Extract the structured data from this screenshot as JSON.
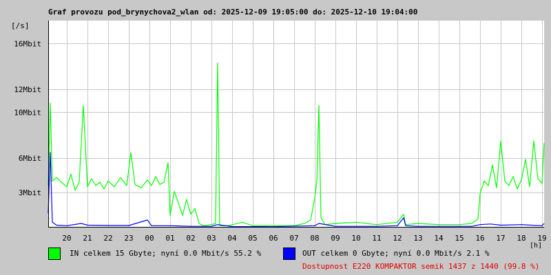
{
  "chart_data": {
    "type": "line",
    "title": "Graf provozu pod_brynychova2_wlan od: 2025-12-09 19:05:00 do: 2025-12-10 19:04:00",
    "ylabel": "[/s]",
    "xlabel": "[h]",
    "ylim": [
      0,
      18
    ],
    "xlim": [
      19.1,
      43.1
    ],
    "y_ticks": [
      {
        "value": 3,
        "label": "3Mbit"
      },
      {
        "value": 6,
        "label": "6Mbit"
      },
      {
        "value": 10,
        "label": "10Mbit"
      },
      {
        "value": 12,
        "label": "12Mbit"
      },
      {
        "value": 16,
        "label": "16Mbit"
      }
    ],
    "x_ticks": [
      {
        "value": 20,
        "label": "20"
      },
      {
        "value": 21,
        "label": "21"
      },
      {
        "value": 22,
        "label": "22"
      },
      {
        "value": 23,
        "label": "23"
      },
      {
        "value": 24,
        "label": "00"
      },
      {
        "value": 25,
        "label": "01"
      },
      {
        "value": 26,
        "label": "02"
      },
      {
        "value": 27,
        "label": "03"
      },
      {
        "value": 28,
        "label": "04"
      },
      {
        "value": 29,
        "label": "05"
      },
      {
        "value": 30,
        "label": "06"
      },
      {
        "value": 31,
        "label": "07"
      },
      {
        "value": 32,
        "label": "08"
      },
      {
        "value": 33,
        "label": "09"
      },
      {
        "value": 34,
        "label": "10"
      },
      {
        "value": 35,
        "label": "11"
      },
      {
        "value": 36,
        "label": "12"
      },
      {
        "value": 37,
        "label": "13"
      },
      {
        "value": 38,
        "label": "14"
      },
      {
        "value": 39,
        "label": "15"
      },
      {
        "value": 40,
        "label": "16"
      },
      {
        "value": 41,
        "label": "17"
      },
      {
        "value": 42,
        "label": "18"
      },
      {
        "value": 43,
        "label": "19"
      }
    ],
    "grid": true,
    "series": [
      {
        "name": "IN",
        "color": "#00ff00",
        "points": [
          [
            19.1,
            3.6
          ],
          [
            19.2,
            10.8
          ],
          [
            19.3,
            4.0
          ],
          [
            19.5,
            4.3
          ],
          [
            19.8,
            3.8
          ],
          [
            20.0,
            3.5
          ],
          [
            20.2,
            4.6
          ],
          [
            20.4,
            3.2
          ],
          [
            20.6,
            3.9
          ],
          [
            20.8,
            10.6
          ],
          [
            21.0,
            3.5
          ],
          [
            21.2,
            4.2
          ],
          [
            21.4,
            3.6
          ],
          [
            21.6,
            3.9
          ],
          [
            21.8,
            3.3
          ],
          [
            22.0,
            4.0
          ],
          [
            22.3,
            3.5
          ],
          [
            22.6,
            4.3
          ],
          [
            22.9,
            3.6
          ],
          [
            23.1,
            6.5
          ],
          [
            23.3,
            3.7
          ],
          [
            23.6,
            3.4
          ],
          [
            23.9,
            4.1
          ],
          [
            24.1,
            3.6
          ],
          [
            24.3,
            4.4
          ],
          [
            24.5,
            3.7
          ],
          [
            24.7,
            3.9
          ],
          [
            24.9,
            5.6
          ],
          [
            25.0,
            1.0
          ],
          [
            25.2,
            3.1
          ],
          [
            25.4,
            2.1
          ],
          [
            25.6,
            1.0
          ],
          [
            25.8,
            2.4
          ],
          [
            26.0,
            1.1
          ],
          [
            26.2,
            1.6
          ],
          [
            26.4,
            0.3
          ],
          [
            26.6,
            0.1
          ],
          [
            27.0,
            0.2
          ],
          [
            27.2,
            0.3
          ],
          [
            27.3,
            14.3
          ],
          [
            27.4,
            0.1
          ],
          [
            27.8,
            0.1
          ],
          [
            28.5,
            0.4
          ],
          [
            29.0,
            0.1
          ],
          [
            31.0,
            0.1
          ],
          [
            31.5,
            0.3
          ],
          [
            31.8,
            0.6
          ],
          [
            32.0,
            2.5
          ],
          [
            32.1,
            4.0
          ],
          [
            32.2,
            10.6
          ],
          [
            32.3,
            0.8
          ],
          [
            32.5,
            0.2
          ],
          [
            33.0,
            0.3
          ],
          [
            34.0,
            0.4
          ],
          [
            35.0,
            0.2
          ],
          [
            36.0,
            0.4
          ],
          [
            36.3,
            1.1
          ],
          [
            36.4,
            0.2
          ],
          [
            37.0,
            0.3
          ],
          [
            38.0,
            0.2
          ],
          [
            39.0,
            0.2
          ],
          [
            39.6,
            0.3
          ],
          [
            39.9,
            0.7
          ],
          [
            40.0,
            2.9
          ],
          [
            40.2,
            4.0
          ],
          [
            40.4,
            3.6
          ],
          [
            40.6,
            5.4
          ],
          [
            40.8,
            3.4
          ],
          [
            41.0,
            7.5
          ],
          [
            41.2,
            4.0
          ],
          [
            41.4,
            3.6
          ],
          [
            41.6,
            4.4
          ],
          [
            41.8,
            3.3
          ],
          [
            42.0,
            4.1
          ],
          [
            42.2,
            5.9
          ],
          [
            42.4,
            3.5
          ],
          [
            42.6,
            7.5
          ],
          [
            42.8,
            4.2
          ],
          [
            43.0,
            3.8
          ],
          [
            43.1,
            7.3
          ]
        ]
      },
      {
        "name": "OUT",
        "color": "#0000ff",
        "points": [
          [
            19.1,
            1.2
          ],
          [
            19.2,
            6.5
          ],
          [
            19.3,
            0.4
          ],
          [
            19.5,
            0.15
          ],
          [
            20.0,
            0.1
          ],
          [
            20.7,
            0.3
          ],
          [
            21.0,
            0.15
          ],
          [
            22.0,
            0.12
          ],
          [
            23.0,
            0.12
          ],
          [
            23.9,
            0.6
          ],
          [
            24.1,
            0.1
          ],
          [
            25.0,
            0.1
          ],
          [
            26.0,
            0.05
          ],
          [
            27.0,
            0.05
          ],
          [
            27.3,
            0.2
          ],
          [
            28.0,
            0.03
          ],
          [
            30.0,
            0.02
          ],
          [
            32.0,
            0.1
          ],
          [
            32.2,
            0.3
          ],
          [
            33.0,
            0.05
          ],
          [
            35.0,
            0.05
          ],
          [
            36.0,
            0.1
          ],
          [
            36.3,
            0.8
          ],
          [
            36.4,
            0.1
          ],
          [
            37.0,
            0.05
          ],
          [
            39.0,
            0.05
          ],
          [
            39.6,
            0.05
          ],
          [
            40.0,
            0.2
          ],
          [
            40.5,
            0.25
          ],
          [
            41.0,
            0.15
          ],
          [
            42.0,
            0.2
          ],
          [
            43.0,
            0.1
          ],
          [
            43.1,
            0.3
          ]
        ]
      }
    ]
  },
  "legend": {
    "in_text": "IN celkem 15 Gbyte; nyní   0.0 Mbit/s 55.2 %",
    "out_text": "OUT celkem 0 Gbyte; nyní   0.0 Mbit/s 2.1 %",
    "in_color": "#00ff00",
    "out_color": "#0000ff"
  },
  "availability": {
    "text": "Dostupnost E220 KOMPAKTOR semik 1437 z 1440 (99.8 %)",
    "color": "#e00000"
  }
}
